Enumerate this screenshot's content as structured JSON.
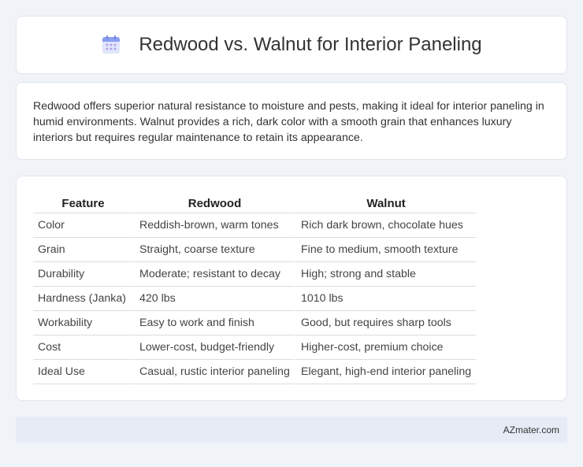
{
  "header": {
    "title": "Redwood vs. Walnut for Interior Paneling",
    "icon": "calendar-icon"
  },
  "intro": {
    "text": "Redwood offers superior natural resistance to moisture and pests, making it ideal for interior paneling in humid environments. Walnut provides a rich, dark color with a smooth grain that enhances luxury interiors but requires regular maintenance to retain its appearance."
  },
  "table": {
    "headers": [
      "Feature",
      "Redwood",
      "Walnut"
    ],
    "rows": [
      [
        "Color",
        "Reddish-brown, warm tones",
        "Rich dark brown, chocolate hues"
      ],
      [
        "Grain",
        "Straight, coarse texture",
        "Fine to medium, smooth texture"
      ],
      [
        "Durability",
        "Moderate; resistant to decay",
        "High; strong and stable"
      ],
      [
        "Hardness (Janka)",
        "420 lbs",
        "1010 lbs"
      ],
      [
        "Workability",
        "Easy to work and finish",
        "Good, but requires sharp tools"
      ],
      [
        "Cost",
        "Lower-cost, budget-friendly",
        "Higher-cost, premium choice"
      ],
      [
        "Ideal Use",
        "Casual, rustic interior paneling",
        "Elegant, high-end interior paneling"
      ]
    ]
  },
  "footer": {
    "text": "AZmater.com"
  },
  "colors": {
    "page_background": "#f0f3f8",
    "card_background": "#ffffff",
    "footer_background": "#e6ebf6",
    "icon_accent": "#8a9ef0"
  }
}
